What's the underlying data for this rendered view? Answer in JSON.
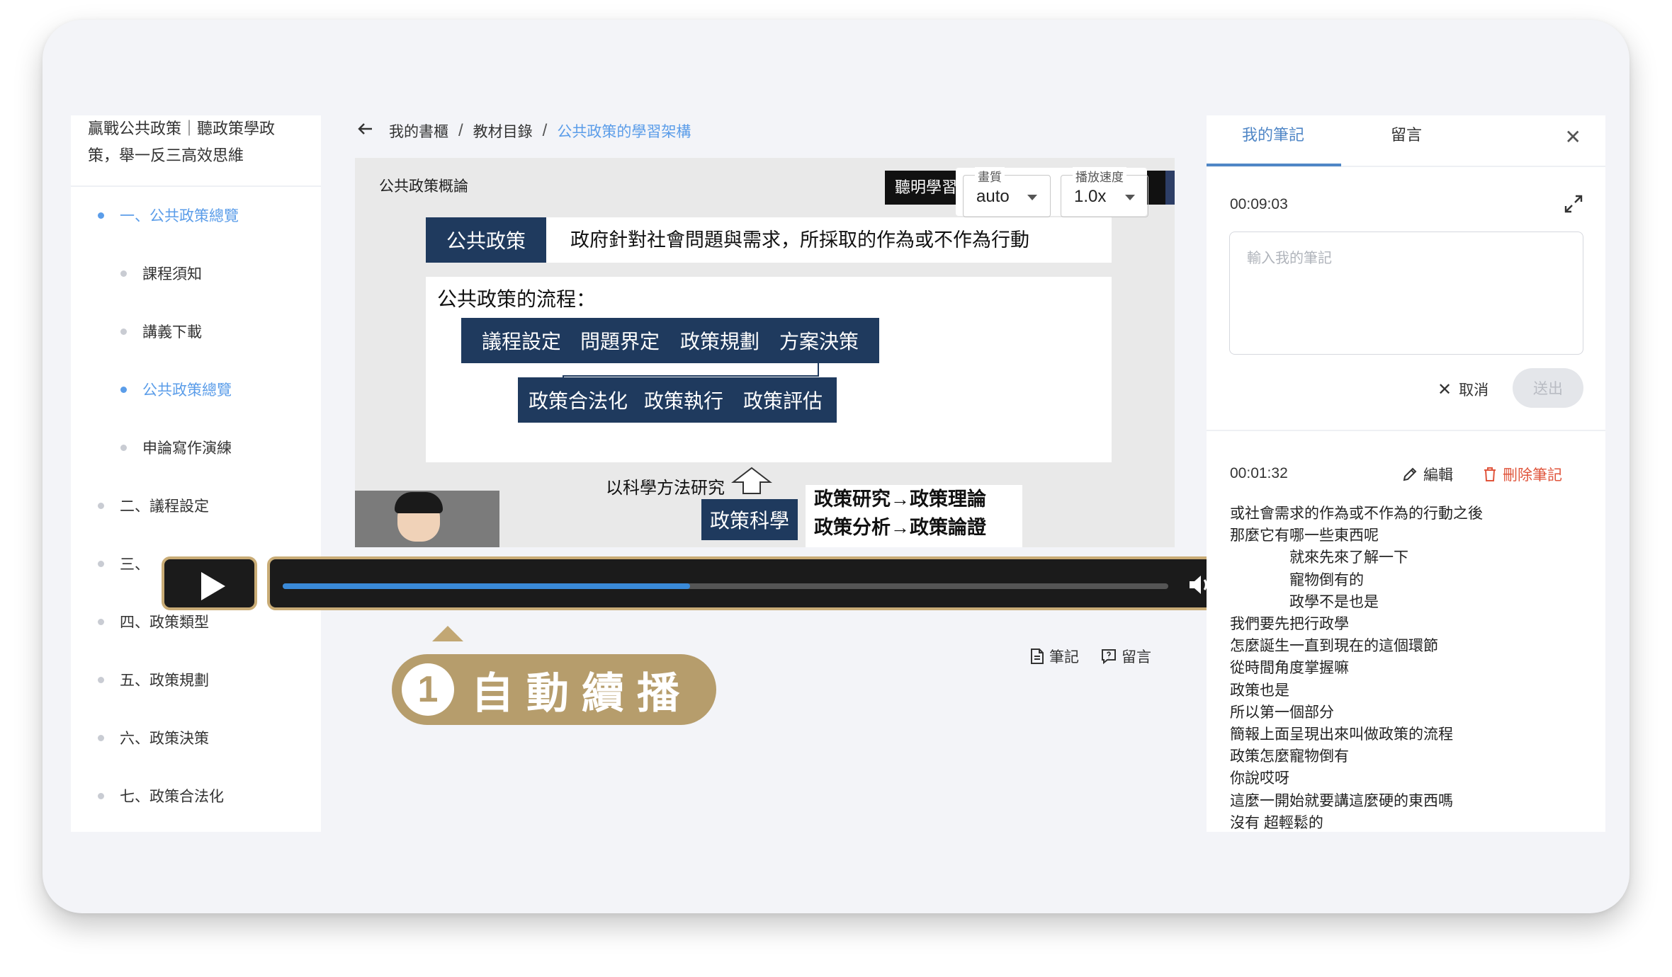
{
  "course": {
    "title": "贏戰公共政策｜聽政策學政策，舉一反三高效思維"
  },
  "sidebar": {
    "items": [
      {
        "label": "一、公共政策總覽",
        "level": 1,
        "active": true
      },
      {
        "label": "課程須知",
        "level": 2,
        "active": false
      },
      {
        "label": "講義下載",
        "level": 2,
        "active": false
      },
      {
        "label": "公共政策總覽",
        "level": 2,
        "active": true
      },
      {
        "label": "申論寫作演練",
        "level": 2,
        "active": false
      },
      {
        "label": "二、議程設定",
        "level": 1,
        "active": false
      },
      {
        "label": "三、",
        "level": 1,
        "active": false
      },
      {
        "label": "四、政策類型",
        "level": 1,
        "active": false
      },
      {
        "label": "五、政策規劃",
        "level": 1,
        "active": false
      },
      {
        "label": "六、政策決策",
        "level": 1,
        "active": false
      },
      {
        "label": "七、政策合法化",
        "level": 1,
        "active": false
      }
    ]
  },
  "breadcrumb": {
    "items": [
      "我的書櫃",
      "教材目錄"
    ],
    "current": "公共政策的學習架構",
    "separator": "/"
  },
  "slide": {
    "header": "公共政策概論",
    "brand": "聽明學習",
    "definition_label": "公共政策",
    "definition_text": "政府針對社會問題與需求，所採取的作為或不作為行動",
    "process_title": "公共政策的流程：",
    "process_row1": [
      "議程設定",
      "問題界定",
      "政策規劃",
      "方案決策"
    ],
    "process_row2": [
      "政策合法化",
      "政策執行",
      "政策評估"
    ],
    "method_text": "以科學方法研究",
    "science_label": "政策科學",
    "research_lines": [
      "政策研究→政策理論",
      "政策分析→政策論證"
    ]
  },
  "player": {
    "quality_label": "畫質",
    "quality_value": "auto",
    "speed_label": "播放速度",
    "speed_value": "1.0x",
    "progress": 0.46
  },
  "callout": {
    "number": "1",
    "text": "自動續播",
    "color": "#b69d6c"
  },
  "note_links": {
    "note": "筆記",
    "comment": "留言"
  },
  "right_panel": {
    "tabs": [
      "我的筆記",
      "留言"
    ],
    "current_time": "00:09:03",
    "input_placeholder": "輸入我的筆記",
    "cancel_label": "取消",
    "send_label": "送出",
    "note": {
      "time": "00:01:32",
      "edit_label": "編輯",
      "delete_label": "刪除筆記",
      "lines": [
        "或社會需求的作為或不作為的行動之後",
        "那麼它有哪一些東西呢",
        "就來先來了解一下",
        "寵物倒有的",
        "政學不是也是",
        "我們要先把行政學",
        "怎麼誕生一直到現在的這個環節",
        "從時間角度掌握嘛",
        "政策也是",
        "所以第一個部分",
        "簡報上面呈現出來叫做政策的流程",
        "政策怎麼寵物倒有",
        "你說哎呀",
        "這麼一開始就要講這麼硬的東西嗎",
        "沒有 超輕鬆的"
      ]
    }
  },
  "colors": {
    "accent": "#5b9de9",
    "navy": "#1f3a5e",
    "gold": "#c9ac76",
    "danger": "#e0553c"
  }
}
